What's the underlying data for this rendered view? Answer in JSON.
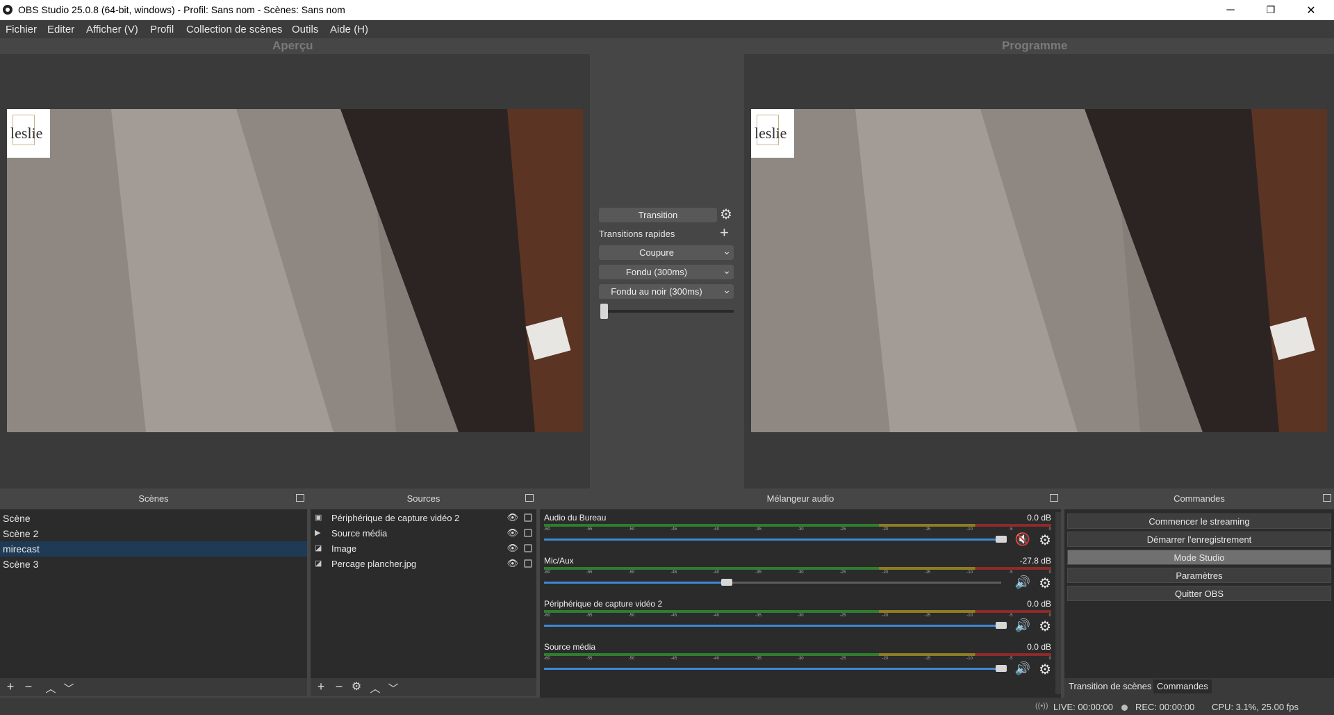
{
  "window": {
    "title": "OBS Studio 25.0.8 (64-bit, windows) - Profil: Sans nom - Scènes: Sans nom",
    "minimize": "─",
    "restore": "❐",
    "close": "✕"
  },
  "menu": [
    "Fichier",
    "Editer",
    "Afficher (V)",
    "Profil",
    "Collection de scènes",
    "Outils",
    "Aide (H)"
  ],
  "preview": {
    "label": "Aperçu",
    "logo_text": "leslie"
  },
  "program": {
    "label": "Programme",
    "logo_text": "leslie"
  },
  "transitions": {
    "transition_button": "Transition",
    "quick_label": "Transitions rapides",
    "quick": [
      "Coupure",
      "Fondu (300ms)",
      "Fondu au noir (300ms)"
    ]
  },
  "scenes": {
    "title": "Scènes",
    "items": [
      "Scène",
      "Scène 2",
      "mirecast",
      "Scène 3"
    ],
    "selected": "mirecast"
  },
  "sources": {
    "title": "Sources",
    "items": [
      {
        "name": "Périphérique de capture vidéo 2",
        "icon": "camera-icon"
      },
      {
        "name": "Source média",
        "icon": "play-icon"
      },
      {
        "name": "Image",
        "icon": "image-icon"
      },
      {
        "name": "Percage plancher.jpg",
        "icon": "image-icon"
      }
    ]
  },
  "mixer": {
    "title": "Mélangeur audio",
    "ticks": [
      "-60",
      "-55",
      "-50",
      "-45",
      "-40",
      "-35",
      "-30",
      "-25",
      "-20",
      "-15",
      "-10",
      "-5",
      "0"
    ],
    "channels": [
      {
        "name": "Audio du Bureau",
        "db": "0.0 dB",
        "level": 1.0,
        "muted": true
      },
      {
        "name": "Mic/Aux",
        "db": "-27.8 dB",
        "level": 0.4,
        "muted": false
      },
      {
        "name": "Périphérique de capture vidéo 2",
        "db": "0.0 dB",
        "level": 1.0,
        "muted": false
      },
      {
        "name": "Source média",
        "db": "0.0 dB",
        "level": 1.0,
        "muted": false
      }
    ]
  },
  "controls": {
    "title": "Commandes",
    "buttons": [
      "Commencer le streaming",
      "Démarrer l'enregistrement",
      "Mode Studio",
      "Paramètres",
      "Quitter OBS"
    ],
    "active": "Mode Studio",
    "tabs": [
      "Transition de scènes",
      "Commandes"
    ]
  },
  "status": {
    "live": "LIVE: 00:00:00",
    "rec": "REC: 00:00:00",
    "cpu": "CPU: 3.1%, 25.00 fps"
  },
  "colors": {
    "accent": "#3e88d6",
    "muted": "#d22222",
    "selected": "#1f3a55"
  }
}
